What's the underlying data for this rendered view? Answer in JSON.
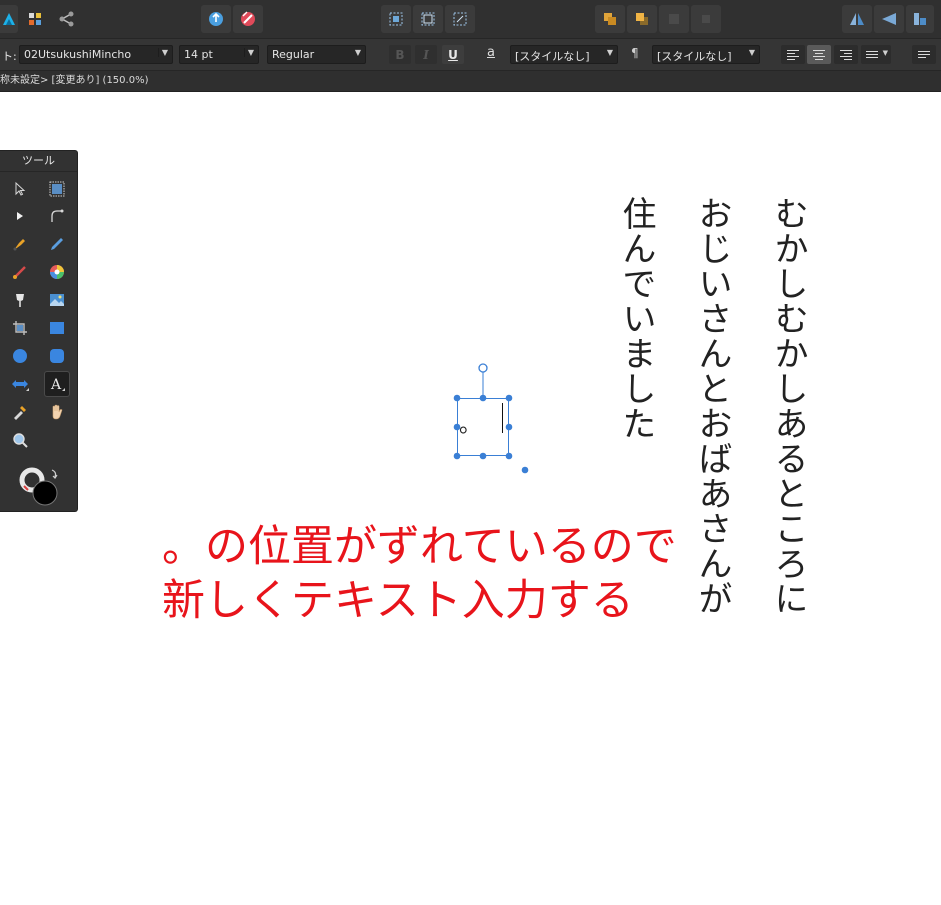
{
  "toolbar": {
    "icons": [
      "affinity-logo-icon",
      "pixel-persona-icon",
      "export-persona-icon",
      "assistant-icon",
      "pen-rotate-icon",
      "snap-box-icon",
      "snap-frame-icon",
      "snap-transform-icon",
      "arrange-back-icon",
      "arrange-front-icon",
      "arrange-disabled-1-icon",
      "arrange-disabled-2-icon",
      "flip-horizontal-icon",
      "flip-vertical-icon",
      "panel-icon"
    ]
  },
  "context": {
    "font_label": "ト:",
    "font_family": "02UtsukushiMincho",
    "font_size": "14 pt",
    "font_style": "Regular",
    "bold": "B",
    "italic": "I",
    "underline": "U",
    "char_style_icon": "a",
    "char_style": "[スタイルなし]",
    "para_style_icon": "¶",
    "para_style": "[スタイルなし]"
  },
  "status": {
    "text": "称未設定> [変更あり] (150.0%)"
  },
  "tools_panel": {
    "title": "ツール"
  },
  "canvas": {
    "columns": [
      "むかしむかしあるところに",
      "おじいさんとおばあさんが",
      "住んでいました"
    ],
    "selected_glyph": "。",
    "note_line1": "。の位置がずれているので",
    "note_line2": "新しくテキスト入力する"
  },
  "colors": {
    "accent": "#1e90ff",
    "selection": "#3a7fd5",
    "note": "#e8141b",
    "ui_dark": "#303030"
  }
}
